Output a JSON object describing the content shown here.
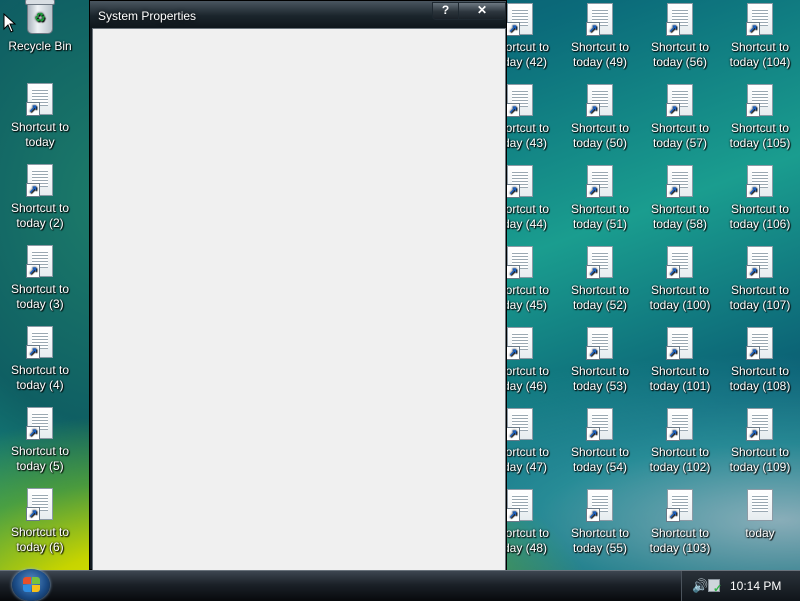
{
  "window": {
    "title": "System Properties",
    "help_label": "?",
    "close_label": "✕"
  },
  "desktop": {
    "recycle_bin": "Recycle Bin",
    "left_column": [
      {
        "line1": "Shortcut to",
        "line2": "today"
      },
      {
        "line1": "Shortcut to",
        "line2": "today (2)"
      },
      {
        "line1": "Shortcut to",
        "line2": "today (3)"
      },
      {
        "line1": "Shortcut to",
        "line2": "today (4)"
      },
      {
        "line1": "Shortcut to",
        "line2": "today (5)"
      },
      {
        "line1": "Shortcut to",
        "line2": "today (6)"
      }
    ],
    "col_a": [
      {
        "line1": "Shortcut to",
        "line2": "today (42)"
      },
      {
        "line1": "Shortcut to",
        "line2": "today (43)"
      },
      {
        "line1": "Shortcut to",
        "line2": "today (44)"
      },
      {
        "line1": "Shortcut to",
        "line2": "today (45)"
      },
      {
        "line1": "Shortcut to",
        "line2": "today (46)"
      },
      {
        "line1": "Shortcut to",
        "line2": "today (47)"
      },
      {
        "line1": "Shortcut to",
        "line2": "today (48)"
      }
    ],
    "col_b": [
      {
        "line1": "Shortcut to",
        "line2": "today (49)"
      },
      {
        "line1": "Shortcut to",
        "line2": "today (50)"
      },
      {
        "line1": "Shortcut to",
        "line2": "today (51)"
      },
      {
        "line1": "Shortcut to",
        "line2": "today (52)"
      },
      {
        "line1": "Shortcut to",
        "line2": "today (53)"
      },
      {
        "line1": "Shortcut to",
        "line2": "today (54)"
      },
      {
        "line1": "Shortcut to",
        "line2": "today (55)"
      }
    ],
    "col_c": [
      {
        "line1": "Shortcut to",
        "line2": "today (56)"
      },
      {
        "line1": "Shortcut to",
        "line2": "today (57)"
      },
      {
        "line1": "Shortcut to",
        "line2": "today (58)"
      },
      {
        "line1": "Shortcut to",
        "line2": "today (100)"
      },
      {
        "line1": "Shortcut to",
        "line2": "today (101)"
      },
      {
        "line1": "Shortcut to",
        "line2": "today (102)"
      },
      {
        "line1": "Shortcut to",
        "line2": "today (103)"
      }
    ],
    "col_d": [
      {
        "line1": "Shortcut to",
        "line2": "today (104)"
      },
      {
        "line1": "Shortcut to",
        "line2": "today (105)"
      },
      {
        "line1": "Shortcut to",
        "line2": "today (106)"
      },
      {
        "line1": "Shortcut to",
        "line2": "today (107)"
      },
      {
        "line1": "Shortcut to",
        "line2": "today (108)"
      },
      {
        "line1": "Shortcut to",
        "line2": "today (109)"
      },
      {
        "line1": "today",
        "line2": ""
      }
    ]
  },
  "taskbar": {
    "clock": "10:14 PM",
    "tray_icons": [
      "speaker-icon",
      "network-icon"
    ]
  }
}
